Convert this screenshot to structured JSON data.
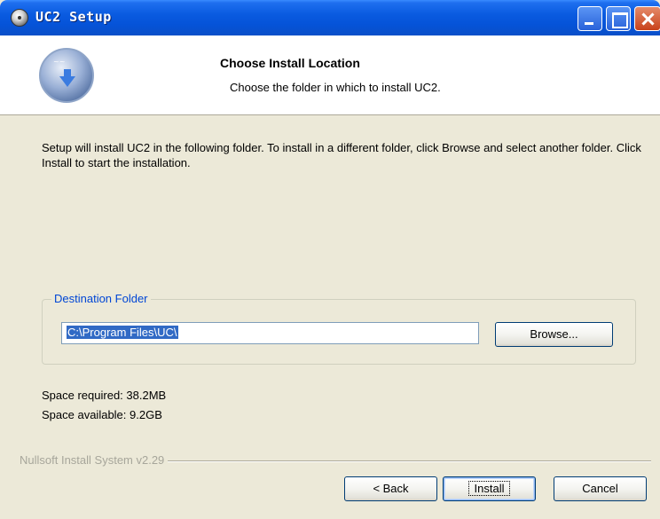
{
  "window": {
    "title": "UC2 Setup",
    "icons": {
      "app": "app-disc-icon",
      "minimize": "minimize-icon",
      "maximize": "maximize-icon",
      "close": "close-icon"
    }
  },
  "header": {
    "title": "Choose Install Location",
    "subtitle": "Choose the folder in which to install UC2.",
    "logo": "installer-logo-icon"
  },
  "intro": "Setup will install UC2 in the following folder. To install in a different folder, click Browse and select another folder. Click Install to start the installation.",
  "destination": {
    "group_label": "Destination Folder",
    "path": "C:\\Program Files\\UC\\",
    "browse_label": "Browse..."
  },
  "space": {
    "required": "Space required: 38.2MB",
    "available": "Space available: 9.2GB"
  },
  "footer": {
    "branding": "Nullsoft Install System v2.29",
    "back_label": "< Back",
    "install_label": "Install",
    "cancel_label": "Cancel"
  },
  "colors": {
    "titlebar": "#0553D8",
    "dialog_bg": "#ECE9D8",
    "group_label": "#0046D5",
    "selection": "#316AC5"
  }
}
